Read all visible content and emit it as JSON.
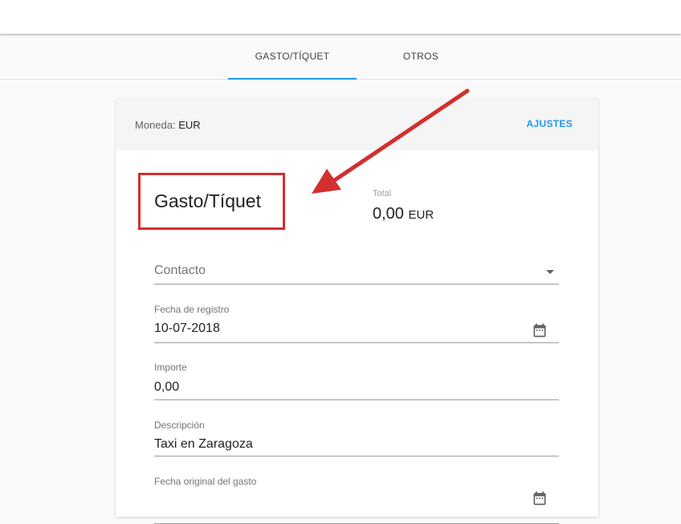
{
  "tabs": [
    {
      "label": "GASTO/TÍQUET",
      "active": true
    },
    {
      "label": "OTROS",
      "active": false
    }
  ],
  "card": {
    "currency_label": "Moneda:",
    "currency_code": "EUR",
    "settings_label": "AJUSTES",
    "title": "Gasto/Tíquet",
    "total_label": "Total",
    "total_value": "0,00",
    "total_currency": "EUR"
  },
  "fields": {
    "contact": {
      "placeholder": "Contacto"
    },
    "register_date": {
      "label": "Fecha de registro",
      "value": "10-07-2018"
    },
    "amount": {
      "label": "Importe",
      "value": "0,00"
    },
    "description": {
      "label": "Descripción",
      "value": "Taxi en Zaragoza"
    },
    "original_date": {
      "label": "Fecha original del gasto"
    }
  },
  "colors": {
    "accent": "#2196f3",
    "annotation": "#d32f2f"
  },
  "icons": {
    "dropdown": "chevron-down-icon",
    "calendar": "calendar-icon"
  }
}
